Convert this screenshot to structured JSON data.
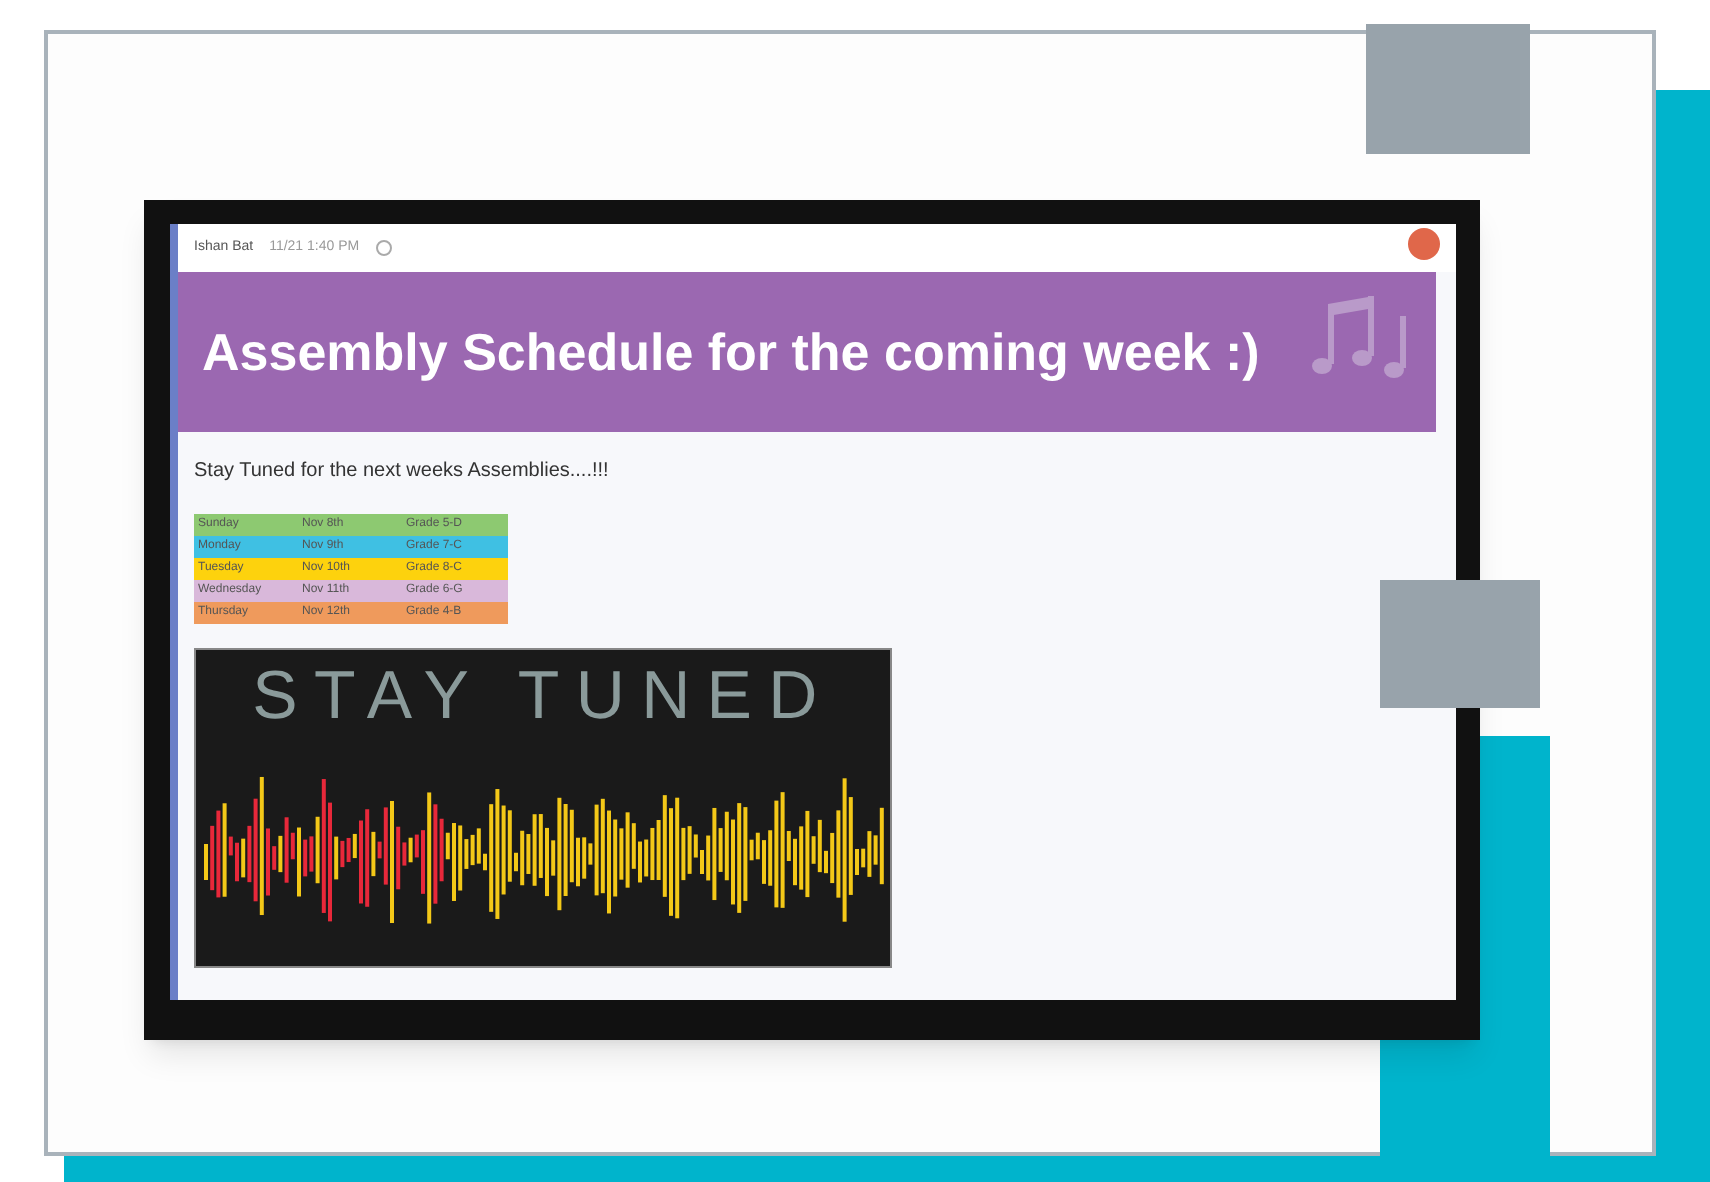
{
  "post": {
    "author": "Ishan Bat",
    "time": "11/21 1:40 PM"
  },
  "banner": {
    "title": "Assembly Schedule for the coming week :)"
  },
  "message": "Stay Tuned for the next weeks Assemblies....!!!",
  "schedule": [
    {
      "day": "Sunday",
      "date": "Nov 8th",
      "grade": "Grade 5-D",
      "color": "#8dc971"
    },
    {
      "day": "Monday",
      "date": "Nov 9th",
      "grade": "Grade 7-C",
      "color": "#3fc0e3"
    },
    {
      "day": "Tuesday",
      "date": "Nov 10th",
      "grade": "Grade 8-C",
      "color": "#fdd20d"
    },
    {
      "day": "Wednesday",
      "date": "Nov 11th",
      "grade": "Grade 6-G",
      "color": "#d9b8da"
    },
    {
      "day": "Thursday",
      "date": "Nov 12th",
      "grade": "Grade 4-B",
      "color": "#ef9a5c"
    }
  ],
  "poster": {
    "heading": "STAY TUNED"
  }
}
